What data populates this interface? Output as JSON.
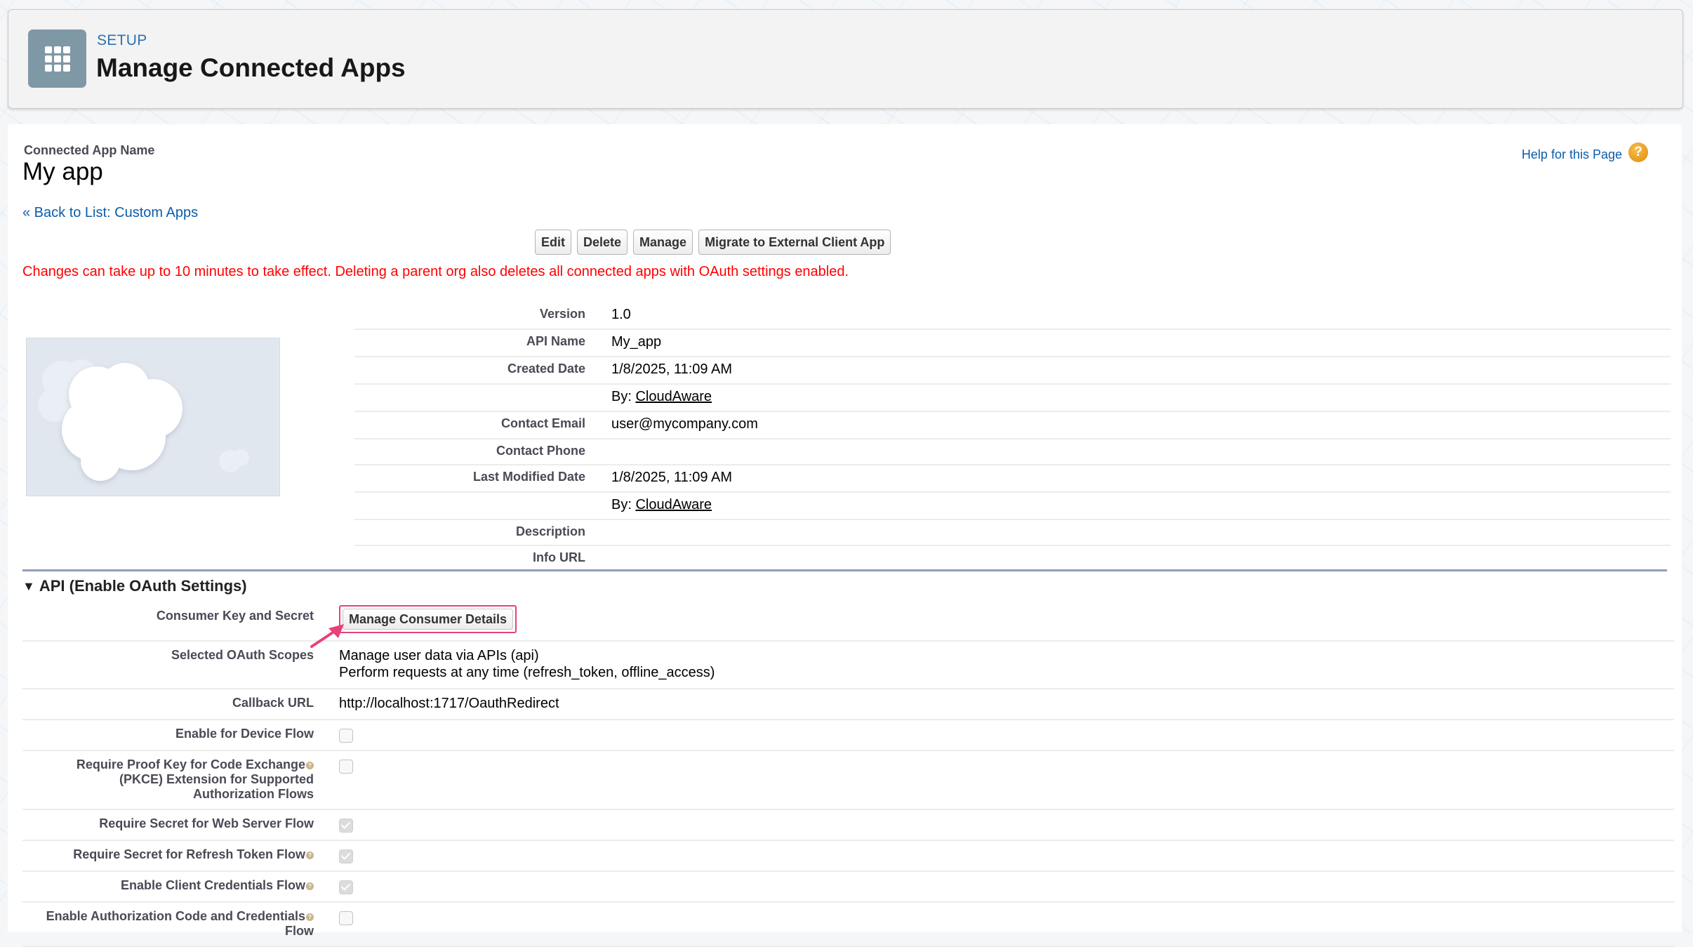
{
  "header": {
    "eyebrow": "SETUP",
    "title": "Manage Connected Apps",
    "icon": "app-grid-icon"
  },
  "page": {
    "app_name_label": "Connected App Name",
    "app_name": "My app",
    "back_link": "« Back to List: Custom Apps",
    "help_link": "Help for this Page",
    "help_icon": "?",
    "warning": "Changes can take up to 10 minutes to take effect. Deleting a parent org also deletes all connected apps with OAuth settings enabled."
  },
  "buttons": {
    "edit": "Edit",
    "delete": "Delete",
    "manage": "Manage",
    "migrate": "Migrate to External Client App"
  },
  "details": [
    {
      "label": "Version",
      "value": "1.0"
    },
    {
      "label": "API Name",
      "value": "My_app"
    },
    {
      "label": "Created Date",
      "value": "1/8/2025, 11:09 AM"
    },
    {
      "label": "",
      "by_prefix": "By: ",
      "by_link": "CloudAware"
    },
    {
      "label": "Contact Email",
      "value": "user@mycompany.com"
    },
    {
      "label": "Contact Phone",
      "value": ""
    },
    {
      "label": "Last Modified Date",
      "value": "1/8/2025, 11:09 AM"
    },
    {
      "label": "",
      "by_prefix": "By: ",
      "by_link": "CloudAware"
    },
    {
      "label": "Description",
      "value": ""
    },
    {
      "label": "Info URL",
      "value": ""
    }
  ],
  "api_section": {
    "title": "API (Enable OAuth Settings)",
    "rows": [
      {
        "label": "Consumer Key and Secret",
        "button": "Manage Consumer Details"
      },
      {
        "label": "Selected OAuth Scopes",
        "lines": [
          "Manage user data via APIs (api)",
          "Perform requests at any time (refresh_token, offline_access)"
        ]
      },
      {
        "label": "Callback URL",
        "value": "http://localhost:1717/OauthRedirect"
      },
      {
        "label": "Enable for Device Flow",
        "checked": false
      },
      {
        "label_lines": [
          "Require Proof Key for Code Exchange",
          "(PKCE) Extension for Supported",
          "Authorization Flows"
        ],
        "checked": false,
        "help": true
      },
      {
        "label": "Require Secret for Web Server Flow",
        "checked": true
      },
      {
        "label": "Require Secret for Refresh Token Flow",
        "checked": true,
        "help": true
      },
      {
        "label": "Enable Client Credentials Flow",
        "checked": true,
        "help": true
      },
      {
        "label_lines": [
          "Enable Authorization Code and Credentials",
          "Flow"
        ],
        "checked": false,
        "help": true
      }
    ]
  },
  "colors": {
    "link": "#0b5cab",
    "warning": "#ff0000",
    "highlight": "#e8417a",
    "icon_bg": "#7f98a6",
    "section_divider": "#8e9dbb"
  }
}
